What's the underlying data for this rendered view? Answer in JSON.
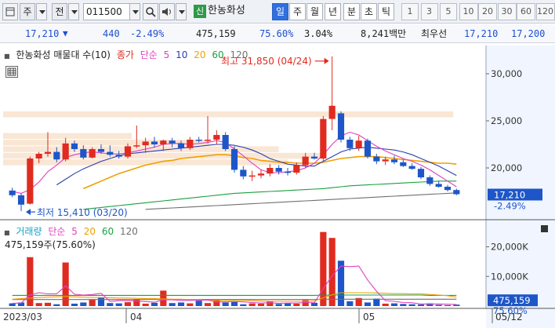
{
  "toolbar": {
    "market": "주",
    "filter": "전",
    "code": "011500",
    "stock_badge": "신",
    "stock_name": "한농화성",
    "periods": [
      "일",
      "주",
      "월",
      "년",
      "분",
      "초",
      "틱"
    ],
    "active_period": "일",
    "intervals": [
      "1",
      "3",
      "5",
      "10",
      "20",
      "30",
      "60",
      "120"
    ]
  },
  "info": {
    "price": "17,210",
    "change": "440",
    "change_pct": "-2.49%",
    "volume": "475,159",
    "vol_ratio": "75.60%",
    "turnover": "3.04%",
    "amount": "8,241백만",
    "hoga_label": "최우선",
    "ask": "17,210",
    "bid": "17,200"
  },
  "price_panel": {
    "legend_name": "한농화성 매물대 수(10)",
    "legend_close": "종가",
    "legend_ma_label": "단순",
    "legend_ma": [
      "5",
      "10",
      "20",
      "60",
      "120"
    ],
    "high_label": "최고 31,850 (04/24)",
    "low_label": "최저 15,410 (03/20)",
    "y_ticks": [
      "30,000",
      "25,000",
      "20,000"
    ],
    "last_price": "17,210",
    "last_pct": "-2.49%"
  },
  "volume_panel": {
    "legend_name": "거래량",
    "legend_ma_label": "단순",
    "legend_ma": [
      "5",
      "20",
      "60",
      "120"
    ],
    "info": "475,159주(75.60%)",
    "y_ticks": [
      "20,000K",
      "10,000K"
    ],
    "last_volume": "475,159",
    "last_pct": "75.60%"
  },
  "x_axis": [
    "2023/03",
    "04",
    "05",
    "05/12"
  ],
  "colors": {
    "up": "#e02b20",
    "down": "#1e56c8",
    "ma5": "#e040c0",
    "ma10": "#2a3fb0",
    "ma20": "#f0a000",
    "ma60": "#1aa040",
    "ma120": "#707070"
  },
  "chart_data": {
    "type": "candlestick",
    "candles": [
      {
        "o": 17600,
        "h": 17900,
        "l": 16900,
        "c": 17100
      },
      {
        "o": 17100,
        "h": 17300,
        "l": 15410,
        "c": 16100
      },
      {
        "o": 16200,
        "h": 21200,
        "l": 16100,
        "c": 21000
      },
      {
        "o": 21000,
        "h": 21700,
        "l": 20500,
        "c": 21500
      },
      {
        "o": 21500,
        "h": 23800,
        "l": 21200,
        "c": 21700
      },
      {
        "o": 21700,
        "h": 22200,
        "l": 20600,
        "c": 20900
      },
      {
        "o": 20900,
        "h": 23200,
        "l": 20700,
        "c": 22600
      },
      {
        "o": 22600,
        "h": 22900,
        "l": 21700,
        "c": 22000
      },
      {
        "o": 22000,
        "h": 22400,
        "l": 20900,
        "c": 21100
      },
      {
        "o": 21100,
        "h": 22200,
        "l": 21000,
        "c": 22000
      },
      {
        "o": 22000,
        "h": 22500,
        "l": 21500,
        "c": 21700
      },
      {
        "o": 21700,
        "h": 22400,
        "l": 21200,
        "c": 21400
      },
      {
        "o": 21400,
        "h": 21800,
        "l": 21000,
        "c": 21200
      },
      {
        "o": 21200,
        "h": 22600,
        "l": 21000,
        "c": 22300
      },
      {
        "o": 22300,
        "h": 24500,
        "l": 22100,
        "c": 22400
      },
      {
        "o": 22400,
        "h": 23200,
        "l": 21600,
        "c": 22800
      },
      {
        "o": 22800,
        "h": 23300,
        "l": 22200,
        "c": 22500
      },
      {
        "o": 22500,
        "h": 23000,
        "l": 21800,
        "c": 22900
      },
      {
        "o": 22900,
        "h": 23200,
        "l": 22200,
        "c": 22600
      },
      {
        "o": 22600,
        "h": 22900,
        "l": 21800,
        "c": 22100
      },
      {
        "o": 22100,
        "h": 23300,
        "l": 21900,
        "c": 23000
      },
      {
        "o": 23000,
        "h": 23300,
        "l": 22700,
        "c": 22900
      },
      {
        "o": 22900,
        "h": 25500,
        "l": 22600,
        "c": 23000
      },
      {
        "o": 23000,
        "h": 24000,
        "l": 22500,
        "c": 23500
      },
      {
        "o": 23500,
        "h": 23800,
        "l": 21800,
        "c": 22000
      },
      {
        "o": 22000,
        "h": 22300,
        "l": 19500,
        "c": 19800
      },
      {
        "o": 19800,
        "h": 20200,
        "l": 18800,
        "c": 19100
      },
      {
        "o": 19100,
        "h": 19700,
        "l": 18600,
        "c": 19200
      },
      {
        "o": 19200,
        "h": 19800,
        "l": 18900,
        "c": 19400
      },
      {
        "o": 19400,
        "h": 20400,
        "l": 19100,
        "c": 20000
      },
      {
        "o": 20000,
        "h": 20300,
        "l": 19300,
        "c": 19600
      },
      {
        "o": 19600,
        "h": 20000,
        "l": 19200,
        "c": 19500
      },
      {
        "o": 19500,
        "h": 20600,
        "l": 19300,
        "c": 20300
      },
      {
        "o": 20300,
        "h": 21600,
        "l": 20000,
        "c": 21200
      },
      {
        "o": 21200,
        "h": 21600,
        "l": 20900,
        "c": 21000
      },
      {
        "o": 21000,
        "h": 25500,
        "l": 20700,
        "c": 25200
      },
      {
        "o": 25200,
        "h": 31850,
        "l": 24000,
        "c": 26600
      },
      {
        "o": 25800,
        "h": 26000,
        "l": 22700,
        "c": 23000
      },
      {
        "o": 23000,
        "h": 23300,
        "l": 21800,
        "c": 22100
      },
      {
        "o": 22100,
        "h": 23400,
        "l": 21800,
        "c": 22900
      },
      {
        "o": 22900,
        "h": 23100,
        "l": 21000,
        "c": 21200
      },
      {
        "o": 21200,
        "h": 21500,
        "l": 20400,
        "c": 20700
      },
      {
        "o": 20700,
        "h": 21200,
        "l": 20300,
        "c": 20900
      },
      {
        "o": 20900,
        "h": 21300,
        "l": 20400,
        "c": 20600
      },
      {
        "o": 20600,
        "h": 20900,
        "l": 20100,
        "c": 20200
      },
      {
        "o": 20200,
        "h": 20500,
        "l": 19800,
        "c": 19900
      },
      {
        "o": 19900,
        "h": 20100,
        "l": 18800,
        "c": 19000
      },
      {
        "o": 19000,
        "h": 19200,
        "l": 18100,
        "c": 18300
      },
      {
        "o": 18300,
        "h": 18600,
        "l": 17900,
        "c": 18000
      },
      {
        "o": 18000,
        "h": 18200,
        "l": 17500,
        "c": 17650
      },
      {
        "o": 17650,
        "h": 17800,
        "l": 17100,
        "c": 17210
      }
    ],
    "volume_k": [
      900,
      1200,
      16500,
      1000,
      1100,
      600,
      14700,
      800,
      1200,
      2100,
      2900,
      1000,
      900,
      1300,
      2300,
      800,
      1100,
      5200,
      1000,
      1200,
      900,
      1800,
      1000,
      2100,
      1200,
      1400,
      600,
      900,
      800,
      1600,
      700,
      900,
      800,
      2000,
      1100,
      25000,
      23000,
      15300,
      1600,
      2700,
      1200,
      2500,
      800,
      900,
      700,
      600,
      500,
      900,
      400,
      300,
      475
    ],
    "ma5": [
      17500,
      17300,
      17700,
      18500,
      19600,
      20300,
      21100,
      21400,
      21600,
      21700,
      21600,
      21500,
      21500,
      21600,
      21800,
      22000,
      22200,
      22500,
      22600,
      22600,
      22500,
      22600,
      22700,
      22900,
      22700,
      22000,
      21300,
      20500,
      19800,
      19500,
      19500,
      19600,
      19700,
      20000,
      20500,
      21400,
      22500,
      23400,
      23800,
      23500,
      22900,
      22300,
      21800,
      21400,
      21000,
      20700,
      20300,
      19800,
      19200,
      18600,
      18000
    ],
    "ma10": [
      null,
      null,
      null,
      null,
      null,
      18200,
      18800,
      19400,
      19900,
      20300,
      20700,
      21000,
      21300,
      21500,
      21600,
      21700,
      21800,
      21900,
      22000,
      22100,
      22200,
      22300,
      22400,
      22500,
      22500,
      22400,
      22200,
      21900,
      21500,
      21000,
      20700,
      20400,
      20300,
      20200,
      20200,
      20700,
      21200,
      21700,
      22000,
      22100,
      22200,
      22100,
      22000,
      21900,
      21700,
      21400,
      21000,
      20600,
      20200,
      19700,
      19200
    ],
    "ma20": [
      null,
      null,
      null,
      null,
      null,
      null,
      null,
      null,
      17800,
      18200,
      18600,
      19000,
      19400,
      19700,
      20000,
      20300,
      20500,
      20700,
      20800,
      21000,
      21100,
      21200,
      21300,
      21400,
      21400,
      21300,
      21100,
      21000,
      20800,
      20700,
      20600,
      20600,
      20500,
      20500,
      20500,
      20600,
      20800,
      21000,
      21100,
      21200,
      21200,
      21200,
      21100,
      21000,
      20900,
      20800,
      20700,
      20600,
      20500,
      20500,
      20400
    ],
    "ma60": [
      null,
      null,
      null,
      null,
      null,
      null,
      null,
      null,
      15600,
      15700,
      15800,
      15900,
      16000,
      16100,
      16200,
      16300,
      16400,
      16500,
      16600,
      16700,
      16800,
      16900,
      17000,
      17100,
      17200,
      17300,
      17350,
      17400,
      17450,
      17500,
      17550,
      17600,
      17650,
      17700,
      17750,
      17800,
      17900,
      18000,
      18100,
      18150,
      18200,
      18250,
      18300,
      18350,
      18400,
      18450,
      18500,
      18550,
      18600,
      18600,
      18600
    ],
    "ma120": [
      null,
      null,
      null,
      null,
      null,
      null,
      null,
      null,
      null,
      null,
      null,
      null,
      null,
      null,
      null,
      15600,
      15650,
      15700,
      15750,
      15800,
      15850,
      15900,
      15950,
      16000,
      16050,
      16100,
      16150,
      16200,
      16250,
      16300,
      16350,
      16400,
      16450,
      16500,
      16550,
      16600,
      16650,
      16700,
      16750,
      16800,
      16850,
      16900,
      16950,
      17000,
      17050,
      17100,
      17150,
      17200,
      17250,
      17300,
      17350
    ],
    "vol_ma5_k": [
      900,
      1000,
      3800,
      4500,
      4100,
      4100,
      6800,
      4000,
      3700,
      3900,
      4300,
      1600,
      1800,
      1800,
      1700,
      1500,
      1300,
      2100,
      2100,
      1900,
      1900,
      2000,
      2000,
      1400,
      1400,
      1500,
      1400,
      1200,
      1000,
      1100,
      900,
      1000,
      1000,
      1200,
      1100,
      5800,
      10200,
      13500,
      13300,
      13500,
      8800,
      5000,
      1800,
      1600,
      1200,
      1100,
      700,
      700,
      700,
      600,
      500
    ],
    "vol_ma20_k": [
      2300,
      2500,
      2700,
      2900,
      3000,
      3100,
      3200,
      3100,
      3000,
      2900,
      2900,
      2800,
      2700,
      2700,
      2600,
      2500,
      2500,
      2400,
      2300,
      2300,
      2200,
      2100,
      2000,
      1900,
      1900,
      1900,
      1900,
      1800,
      1700,
      1600,
      1600,
      1600,
      1600,
      1600,
      1700,
      2800,
      3800,
      4500,
      4500,
      4500,
      4500,
      4400,
      4300,
      4200,
      4200,
      4100,
      4100,
      3900,
      3700,
      3500,
      3000
    ],
    "vol_ma60_k": [
      3600,
      3600,
      3600,
      3600,
      3600,
      3600,
      3600,
      3600,
      3600,
      3600,
      3600,
      3600,
      3600,
      3600,
      3600,
      3600,
      3600,
      3600,
      3600,
      3600,
      3600,
      3600,
      3600,
      3600,
      3600,
      3600,
      3600,
      3600,
      3600,
      3600,
      3600,
      3600,
      3600,
      3600,
      3600,
      3700,
      3700,
      3700,
      3700,
      3700,
      3700,
      3700,
      3700,
      3700,
      3700,
      3700,
      3700,
      3600,
      3600,
      3600,
      3600
    ],
    "vol_ma120_k": [
      2200,
      2200,
      2200,
      2200,
      2200,
      2200,
      2200,
      2200,
      2200,
      2200,
      2200,
      2200,
      2200,
      2200,
      2200,
      2200,
      2200,
      2200,
      2200,
      2200,
      2200,
      2200,
      2200,
      2200,
      2200,
      2200,
      2200,
      2200,
      2200,
      2200,
      2200,
      2200,
      2200,
      2200,
      2200,
      2300,
      2300,
      2300,
      2300,
      2300,
      2300,
      2300,
      2300,
      2300,
      2300,
      2300,
      2300,
      2300,
      2300,
      2300,
      2300
    ],
    "price_range": [
      14500,
      33000
    ],
    "volume_range_k": [
      0,
      26500
    ],
    "supply_zones": [
      {
        "low": 25300,
        "high": 26000,
        "weight": 0.98
      },
      {
        "low": 23000,
        "high": 23700,
        "weight": 0.28
      },
      {
        "low": 22300,
        "high": 23000,
        "weight": 0.45
      },
      {
        "low": 21600,
        "high": 22300,
        "weight": 0.6
      },
      {
        "low": 20900,
        "high": 21600,
        "weight": 0.7
      },
      {
        "low": 20200,
        "high": 20900,
        "weight": 0.62
      }
    ]
  }
}
